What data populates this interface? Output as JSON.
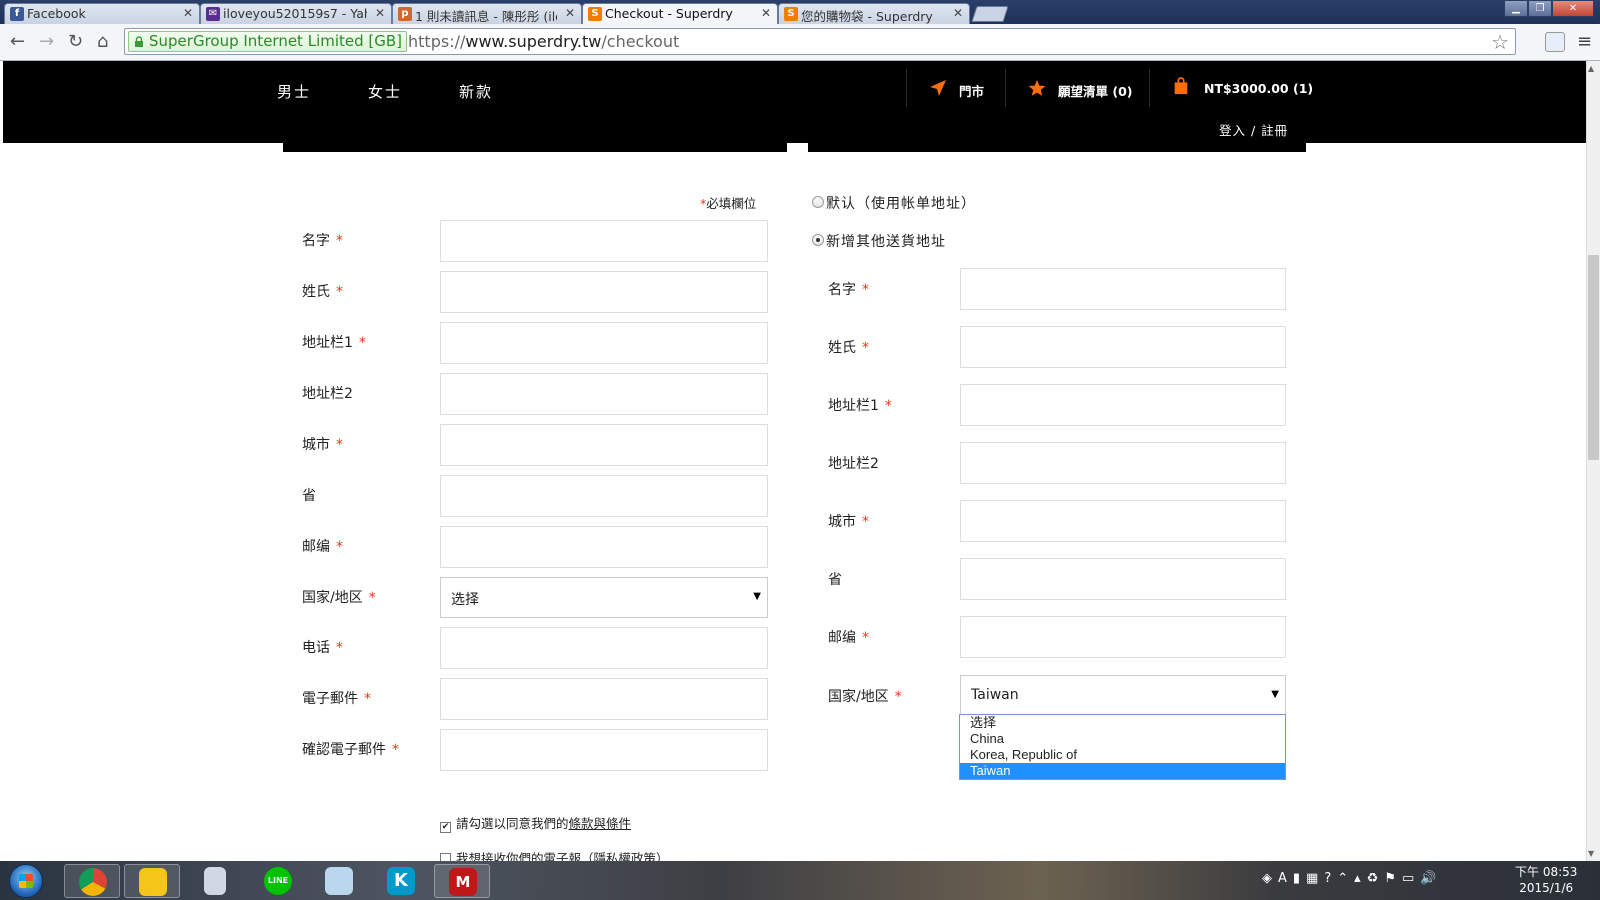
{
  "browser": {
    "tabs": [
      {
        "title": "Facebook",
        "favicon": "facebook-icon",
        "color": "#3b5998",
        "glyph": "f"
      },
      {
        "title": "iloveyou520159s7 - Yah",
        "favicon": "mail-icon",
        "color": "#5c2d91",
        "glyph": "✉"
      },
      {
        "title": "1 則未讀訊息 - 陳彤彤 (ilo",
        "favicon": "plurk-icon",
        "color": "#cf682f",
        "glyph": "p"
      },
      {
        "title": "Checkout - Superdry",
        "favicon": "superdry-icon",
        "color": "#f07d00",
        "glyph": "S"
      },
      {
        "title": "您的購物袋 - Superdry",
        "favicon": "superdry-icon",
        "color": "#f07d00",
        "glyph": "S"
      }
    ],
    "active_tab": 3,
    "ev_label": "SuperGroup Internet Limited [GB]",
    "url_scheme": "https://",
    "url_host": "www.superdry.tw",
    "url_path": "/checkout"
  },
  "site": {
    "nav": [
      "男士",
      "女士",
      "新款"
    ],
    "stores": "門市",
    "wishlist": "願望清單",
    "wishlist_count": "(0)",
    "cart_total": "NT$3000.00",
    "cart_count": "(1)",
    "login": "登入 / 註冊",
    "accent": "#ff6c0a"
  },
  "billing": {
    "required_note": "必填欄位",
    "fields": [
      "名字",
      "姓氏",
      "地址栏1",
      "地址栏2",
      "城市",
      "省",
      "邮编",
      "国家/地区",
      "电话",
      "電子郵件",
      "確認電子郵件"
    ],
    "required": [
      true,
      true,
      true,
      false,
      true,
      false,
      true,
      true,
      true,
      true,
      true
    ],
    "country_value": "选择"
  },
  "shipping": {
    "option_default": "默认（使用帐单地址）",
    "option_new": "新增其他送貨地址",
    "fields": [
      "名字",
      "姓氏",
      "地址栏1",
      "地址栏2",
      "城市",
      "省",
      "邮编",
      "国家/地区"
    ],
    "required": [
      true,
      true,
      true,
      false,
      true,
      false,
      true,
      true
    ],
    "country_value": "Taiwan",
    "country_options": [
      "选择",
      "China",
      "Korea, Republic of",
      "Taiwan"
    ]
  },
  "consent": {
    "terms_prefix": "請勾選以同意我們的",
    "terms_link": "條款與條件",
    "newsletter": "我想接收你們的電子報（隱私權政策）"
  },
  "taskbar": {
    "clock_time": "下午 08:53",
    "clock_date": "2015/1/6",
    "tray": "A"
  }
}
